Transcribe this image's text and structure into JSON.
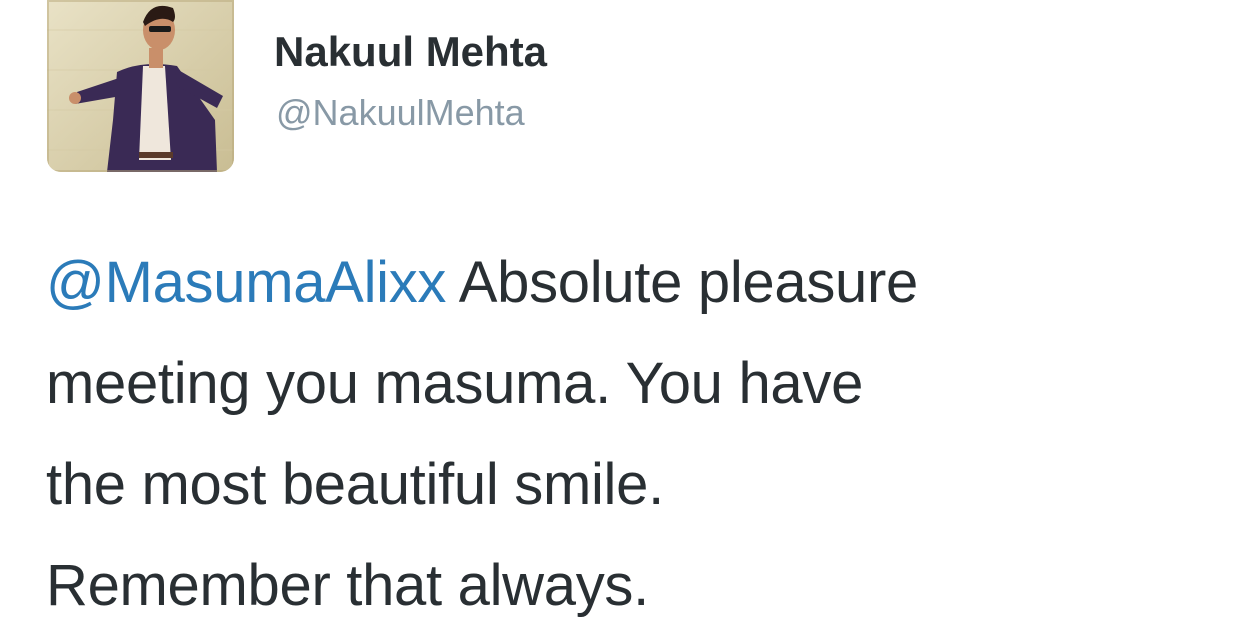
{
  "tweet": {
    "user": {
      "name": "Nakuul Mehta",
      "handle": "@NakuulMehta",
      "avatar_icon": "profile-photo"
    },
    "mention": "@MasumaAlixx",
    "lines": [
      " Absolute pleasure",
      "meeting you masuma. You have",
      "the most beautiful smile.",
      "Remember that always."
    ],
    "colors": {
      "text": "#292f33",
      "mention": "#2b7bb9",
      "handle": "#8899a6"
    }
  }
}
